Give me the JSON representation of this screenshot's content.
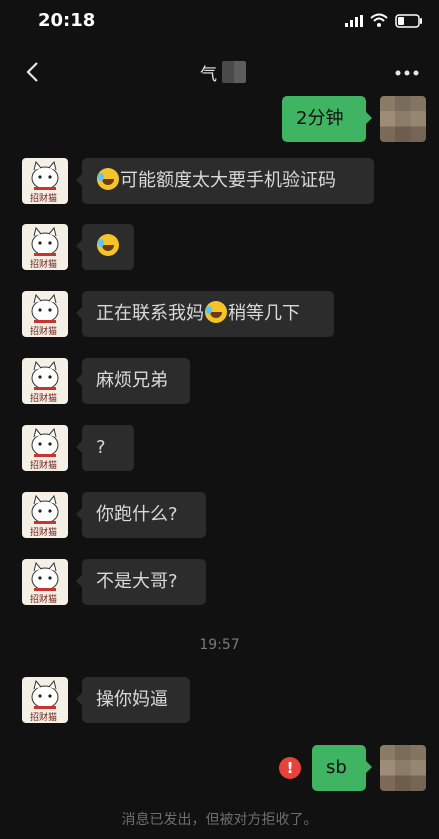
{
  "status_bar": {
    "time": "20:18"
  },
  "header": {
    "title": "气",
    "more_icon": "more-icon",
    "back_icon": "back-icon"
  },
  "messages": [
    {
      "side": "out",
      "text": "2分钟"
    },
    {
      "side": "in",
      "parts": [
        {
          "emoji": "face-with-tears-of-joy"
        },
        {
          "text": "可能额度太大要手机验证码"
        }
      ]
    },
    {
      "side": "in",
      "parts": [
        {
          "emoji": "face-with-tears-of-joy"
        }
      ]
    },
    {
      "side": "in",
      "parts": [
        {
          "text": "正在联系我妈"
        },
        {
          "emoji": "face-with-tears-of-joy"
        },
        {
          "text": "稍等几下"
        }
      ]
    },
    {
      "side": "in",
      "text": "麻烦兄弟"
    },
    {
      "side": "in",
      "text": "?"
    },
    {
      "side": "in",
      "text": "你跑什么?"
    },
    {
      "side": "in",
      "text": "不是大哥?"
    },
    {
      "side": "in",
      "text": "操你妈逼"
    },
    {
      "side": "out",
      "text": "sb",
      "status": "failed"
    }
  ],
  "time_divider": "19:57",
  "system_note": "消息已发出，但被对方拒收了。",
  "colors": {
    "background": "#111111",
    "incoming_bubble": "#2c2c2c",
    "outgoing_bubble": "#3fb462",
    "error": "#e8433b"
  }
}
